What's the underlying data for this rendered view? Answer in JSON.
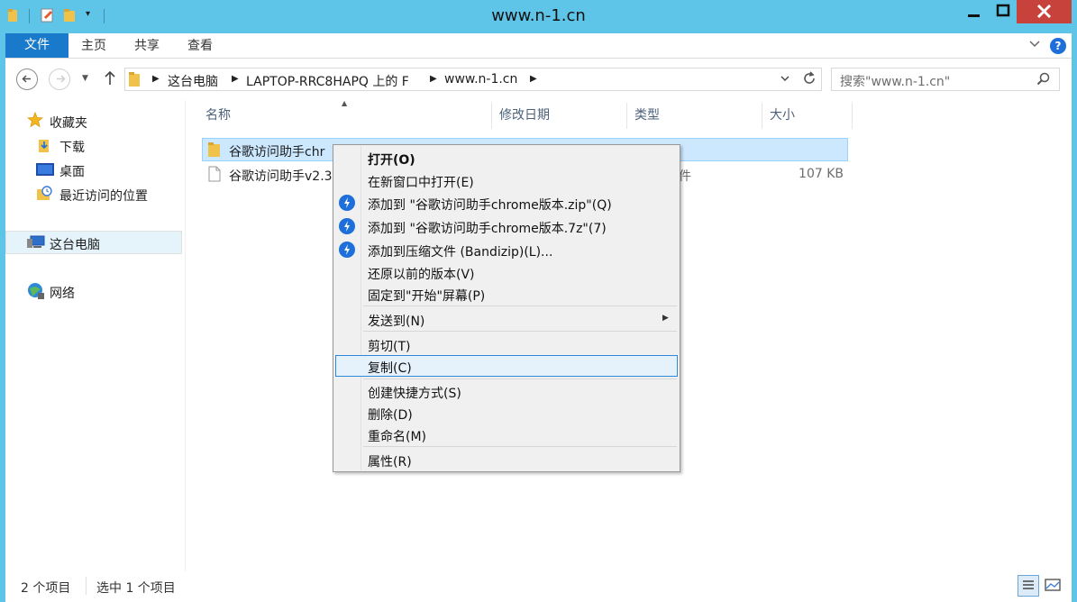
{
  "window": {
    "title": "www.n-1.cn"
  },
  "titlebar_buttons": {
    "minimize": "—",
    "maximize": "□",
    "close": "✕"
  },
  "ribbon": {
    "tabs": [
      "文件",
      "主页",
      "共享",
      "查看"
    ]
  },
  "address": {
    "crumbs": [
      "这台电脑",
      "LAPTOP-RRC8HAPQ 上的 F",
      "www.n-1.cn"
    ],
    "search_placeholder": "搜索\"www.n-1.cn\""
  },
  "sidebar": {
    "favorites": {
      "label": "收藏夹",
      "items": [
        "下载",
        "桌面",
        "最近访问的位置"
      ]
    },
    "this_pc": "这台电脑",
    "network": "网络"
  },
  "columns": [
    "名称",
    "修改日期",
    "类型",
    "大小"
  ],
  "files": [
    {
      "name": "谷歌访问助手chr",
      "size": ""
    },
    {
      "name": "谷歌访问助手v2.3",
      "type_tail": "件",
      "size": "107 KB"
    }
  ],
  "context_menu": {
    "items": [
      "打开(O)",
      "在新窗口中打开(E)",
      "添加到 \"谷歌访问助手chrome版本.zip\"(Q)",
      "添加到 \"谷歌访问助手chrome版本.7z\"(7)",
      "添加到压缩文件 (Bandizip)(L)...",
      "还原以前的版本(V)",
      "固定到\"开始\"屏幕(P)",
      "发送到(N)",
      "剪切(T)",
      "复制(C)",
      "创建快捷方式(S)",
      "删除(D)",
      "重命名(M)",
      "属性(R)"
    ],
    "submenu_arrow": "▶"
  },
  "status": {
    "count": "2 个项目",
    "selected": "选中 1 个项目"
  },
  "colors": {
    "title_bg": "#5ec4e8",
    "file_tab": "#1979ca",
    "selection": "#cce8ff",
    "close": "#c7423a"
  }
}
